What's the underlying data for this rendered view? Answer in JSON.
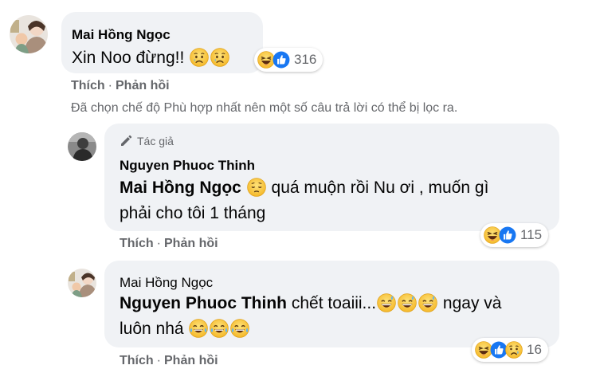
{
  "comment1": {
    "author": "Mai Hồng Ngọc",
    "text": "Xin Noo đừng!!",
    "reaction_count": "316",
    "like_label": "Thích",
    "reply_label": "Phản hồi"
  },
  "filter_notice": "Đã chọn chế độ Phù hợp nhất nên một số câu trả lời có thể bị lọc ra.",
  "reply1": {
    "author_badge": "Tác giả",
    "author": "Nguyen Phuoc Thinh",
    "mention": "Mai Hồng Ngọc",
    "text_line1": "quá muộn rồi Nu ơi , muốn gì",
    "text_line2": "phải cho tôi 1 tháng",
    "reaction_count": "115",
    "like_label": "Thích",
    "reply_label": "Phản hồi"
  },
  "reply2": {
    "author": "Mai Hồng Ngọc",
    "mention": "Nguyen Phuoc Thinh",
    "text_part1": "chết toaiii...",
    "text_part2": "ngay và",
    "text_line2": "luôn nhá",
    "reaction_count": "16",
    "like_label": "Thích",
    "reply_label": "Phản hồi"
  },
  "colors": {
    "bubble": "#f0f2f5",
    "secondary_text": "#65676b",
    "like_blue": "#1877f2",
    "haha_yellow": "#f7c843"
  },
  "icons": [
    "haha-icon",
    "like-icon",
    "sad-icon",
    "sad-face-emoji",
    "pensive-emoji",
    "sweat-smile-emoji",
    "laughing-tears-emoji",
    "pencil-icon"
  ]
}
